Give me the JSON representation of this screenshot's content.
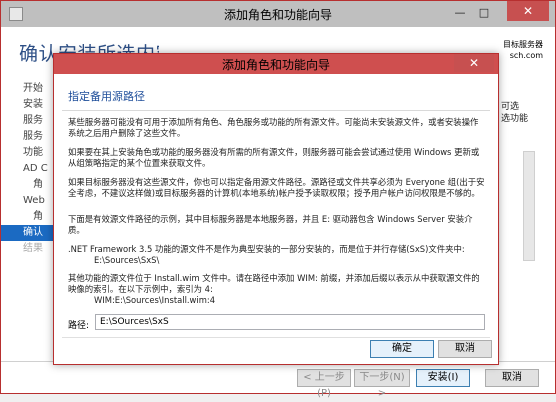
{
  "background_window": {
    "title": "添加角色和功能向导",
    "controls": {
      "minimize": "—",
      "maximize": "□",
      "close": "✕"
    },
    "heading": "确认安装所选内容",
    "server_label": "目标服务器",
    "server_name": "sch.com",
    "nav": [
      {
        "label": "开始",
        "state": "normal",
        "indent": false
      },
      {
        "label": "安装",
        "state": "normal",
        "indent": false
      },
      {
        "label": "服务",
        "state": "normal",
        "indent": false
      },
      {
        "label": "服务",
        "state": "normal",
        "indent": false
      },
      {
        "label": "功能",
        "state": "normal",
        "indent": false
      },
      {
        "label": "AD C",
        "state": "normal",
        "indent": false
      },
      {
        "label": "角",
        "state": "normal",
        "indent": true
      },
      {
        "label": "Web",
        "state": "normal",
        "indent": false
      },
      {
        "label": "角",
        "state": "normal",
        "indent": true
      },
      {
        "label": "确认",
        "state": "active",
        "indent": false
      },
      {
        "label": "结果",
        "state": "disabled",
        "indent": false
      }
    ],
    "right_text": [
      "可选",
      "选功能"
    ],
    "buttons": {
      "prev": "< 上一步(P)",
      "next": "下一步(N) >",
      "install": "安装(I)",
      "cancel": "取消"
    }
  },
  "dialog": {
    "title": "添加角色和功能向导",
    "close": "✕",
    "heading": "指定备用源路径",
    "paragraphs": [
      "某些服务器可能没有可用于添加所有角色、角色服务或功能的所有源文件。可能尚未安装源文件，或者安装操作系统之后用户删除了这些文件。",
      "如果要在其上安装角色或功能的服务器没有所需的所有源文件，则服务器可能会尝试通过使用 Windows 更新或从组策略指定的某个位置来获取文件。",
      "如果目标服务器没有这些源文件，你也可以指定备用源文件路径。源路径或文件共享必须为 Everyone 组(出于安全考虑，不建议这样做)或目标服务器的计算机(本地系统)帐户授予读取权限；授予用户帐户访问权限是不够的。",
      "下面是有效源文件路径的示例，其中目标服务器是本地服务器，并且 E: 驱动器包含 Windows Server 安装介质。"
    ],
    "example1_text": ".NET Framework 3.5 功能的源文件不是作为典型安装的一部分安装的，而是位于并行存储(SxS)文件夹中:",
    "example1_path": "E:\\Sources\\SxS\\",
    "example2_text": "其他功能的源文件位于 Install.wim 文件中。请在路径中添加 WIM: 前缀，并添加后缀以表示从中获取源文件的映像的索引。在以下示例中，索引为 4:",
    "example2_path": "WIM:E:\\Sources\\Install.wim:4",
    "path_label": "路径:",
    "path_value": "E:\\SOurces\\SxS",
    "ok": "确定",
    "cancel": "取消"
  }
}
